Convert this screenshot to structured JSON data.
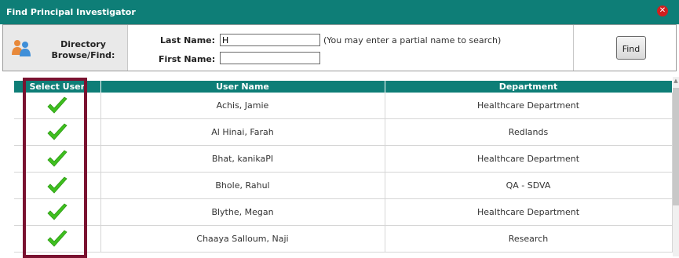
{
  "dialog": {
    "title": "Find Principal Investigator",
    "close_icon": "close-icon"
  },
  "search": {
    "directory_label_1": "Directory",
    "directory_label_2": "Browse/Find:",
    "last_name_label": "Last Name:",
    "last_name_value": "H",
    "first_name_label": "First Name:",
    "first_name_value": "",
    "hint": "(You may enter a partial name to search)",
    "find_label": "Find"
  },
  "grid": {
    "headers": [
      "Select User",
      "User Name",
      "Department"
    ],
    "rows": [
      {
        "name": "Achis, Jamie",
        "department": "Healthcare Department"
      },
      {
        "name": "Al Hinai, Farah",
        "department": "Redlands"
      },
      {
        "name": "Bhat, kanikaPI",
        "department": "Healthcare Department"
      },
      {
        "name": "Bhole, Rahul",
        "department": "QA - SDVA"
      },
      {
        "name": "Blythe, Megan",
        "department": "Healthcare Department"
      },
      {
        "name": "Chaaya Salloum, Naji",
        "department": "Research"
      }
    ]
  },
  "colors": {
    "header_teal": "#0e7e77",
    "highlight": "#7a1230",
    "check_green": "#3fbf1f"
  }
}
